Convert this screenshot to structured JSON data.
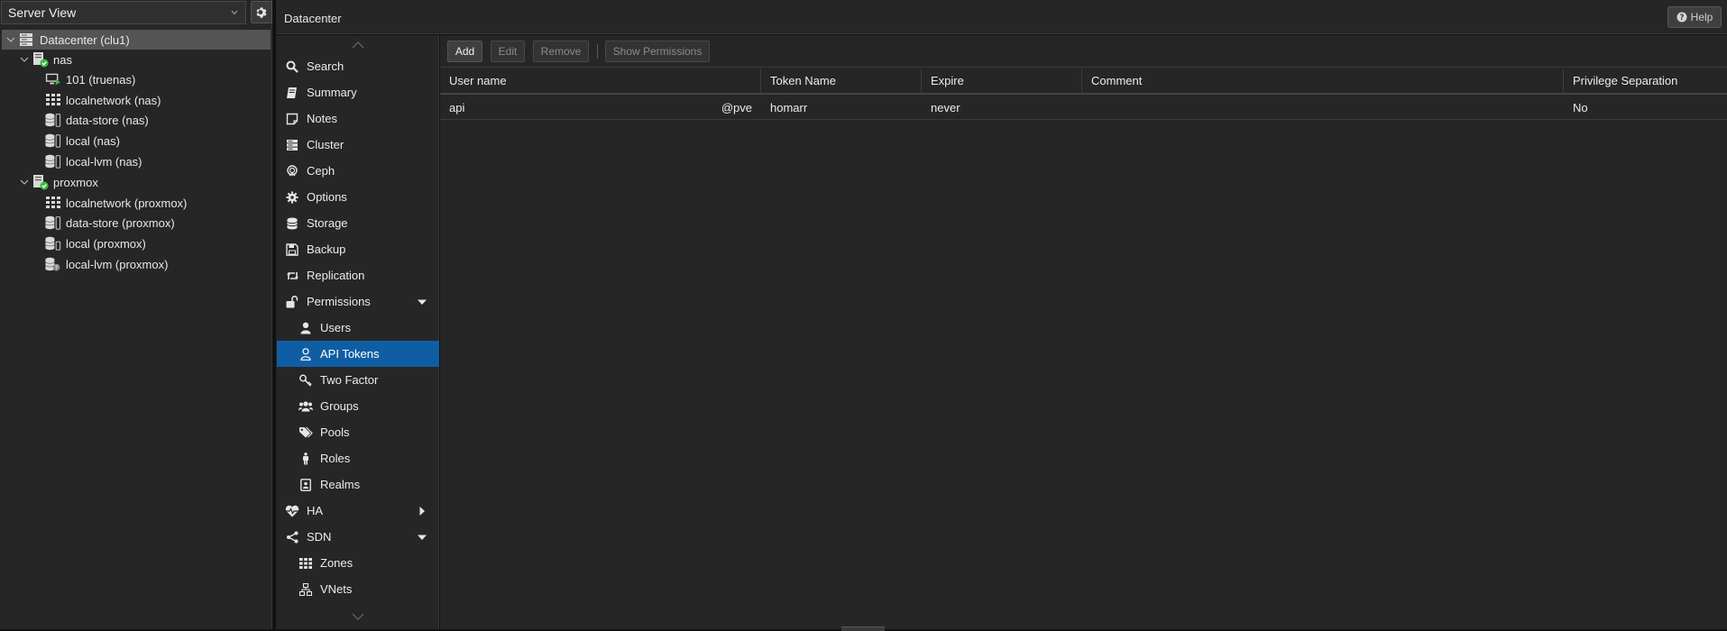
{
  "resource_tree": {
    "view_label": "Server View",
    "nodes": [
      {
        "label": "Datacenter (clu1)",
        "icon": "datacenter-icon",
        "depth": 0
      },
      {
        "label": "nas",
        "icon": "node-online-icon",
        "depth": 1
      },
      {
        "label": "101 (truenas)",
        "icon": "vm-running-icon",
        "depth": 2
      },
      {
        "label": "localnetwork (nas)",
        "icon": "network-grid-icon",
        "depth": 2
      },
      {
        "label": "data-store (nas)",
        "icon": "storage-icon",
        "depth": 2
      },
      {
        "label": "local (nas)",
        "icon": "storage-icon",
        "depth": 2
      },
      {
        "label": "local-lvm (nas)",
        "icon": "storage-icon",
        "depth": 2
      },
      {
        "label": "proxmox",
        "icon": "node-online-icon",
        "depth": 1
      },
      {
        "label": "localnetwork (proxmox)",
        "icon": "network-grid-icon",
        "depth": 2
      },
      {
        "label": "data-store (proxmox)",
        "icon": "storage-icon",
        "depth": 2
      },
      {
        "label": "local (proxmox)",
        "icon": "storage-icon",
        "depth": 2
      },
      {
        "label": "local-lvm (proxmox)",
        "icon": "storage-unknown-icon",
        "depth": 2
      }
    ]
  },
  "header": {
    "title": "Datacenter",
    "help_label": "Help"
  },
  "nav": {
    "items": [
      {
        "label": "Search",
        "icon": "search-icon",
        "sub": false
      },
      {
        "label": "Summary",
        "icon": "book-icon",
        "sub": false
      },
      {
        "label": "Notes",
        "icon": "note-icon",
        "sub": false
      },
      {
        "label": "Cluster",
        "icon": "server-stack-icon",
        "sub": false
      },
      {
        "label": "Ceph",
        "icon": "ceph-icon",
        "sub": false
      },
      {
        "label": "Options",
        "icon": "gear-icon",
        "sub": false
      },
      {
        "label": "Storage",
        "icon": "database-icon",
        "sub": false
      },
      {
        "label": "Backup",
        "icon": "floppy-icon",
        "sub": false
      },
      {
        "label": "Replication",
        "icon": "retweet-icon",
        "sub": false
      },
      {
        "label": "Permissions",
        "icon": "unlock-icon",
        "sub": false
      },
      {
        "label": "Users",
        "icon": "user-icon",
        "sub": true
      },
      {
        "label": "API Tokens",
        "icon": "user-outline-icon",
        "sub": true
      },
      {
        "label": "Two Factor",
        "icon": "key-icon",
        "sub": true
      },
      {
        "label": "Groups",
        "icon": "users-icon",
        "sub": true
      },
      {
        "label": "Pools",
        "icon": "tags-icon",
        "sub": true
      },
      {
        "label": "Roles",
        "icon": "male-icon",
        "sub": true
      },
      {
        "label": "Realms",
        "icon": "id-badge-icon",
        "sub": true
      },
      {
        "label": "HA",
        "icon": "heartbeat-icon",
        "sub": false
      },
      {
        "label": "SDN",
        "icon": "sdn-icon",
        "sub": false
      },
      {
        "label": "Zones",
        "icon": "grid-icon",
        "sub": true
      },
      {
        "label": "VNets",
        "icon": "sitemap-icon",
        "sub": true
      }
    ]
  },
  "toolbar": {
    "add": "Add",
    "edit": "Edit",
    "remove": "Remove",
    "show_permissions": "Show Permissions"
  },
  "grid": {
    "columns": [
      "User name",
      "Token Name",
      "Expire",
      "Comment",
      "Privilege Separation"
    ],
    "rows": [
      {
        "user": "api",
        "realm": "@pve",
        "token": "homarr",
        "expire": "never",
        "comment": "",
        "privsep": "No"
      }
    ]
  },
  "colors": {
    "accent": "#0f5ea3",
    "online": "#3cbc3c"
  }
}
